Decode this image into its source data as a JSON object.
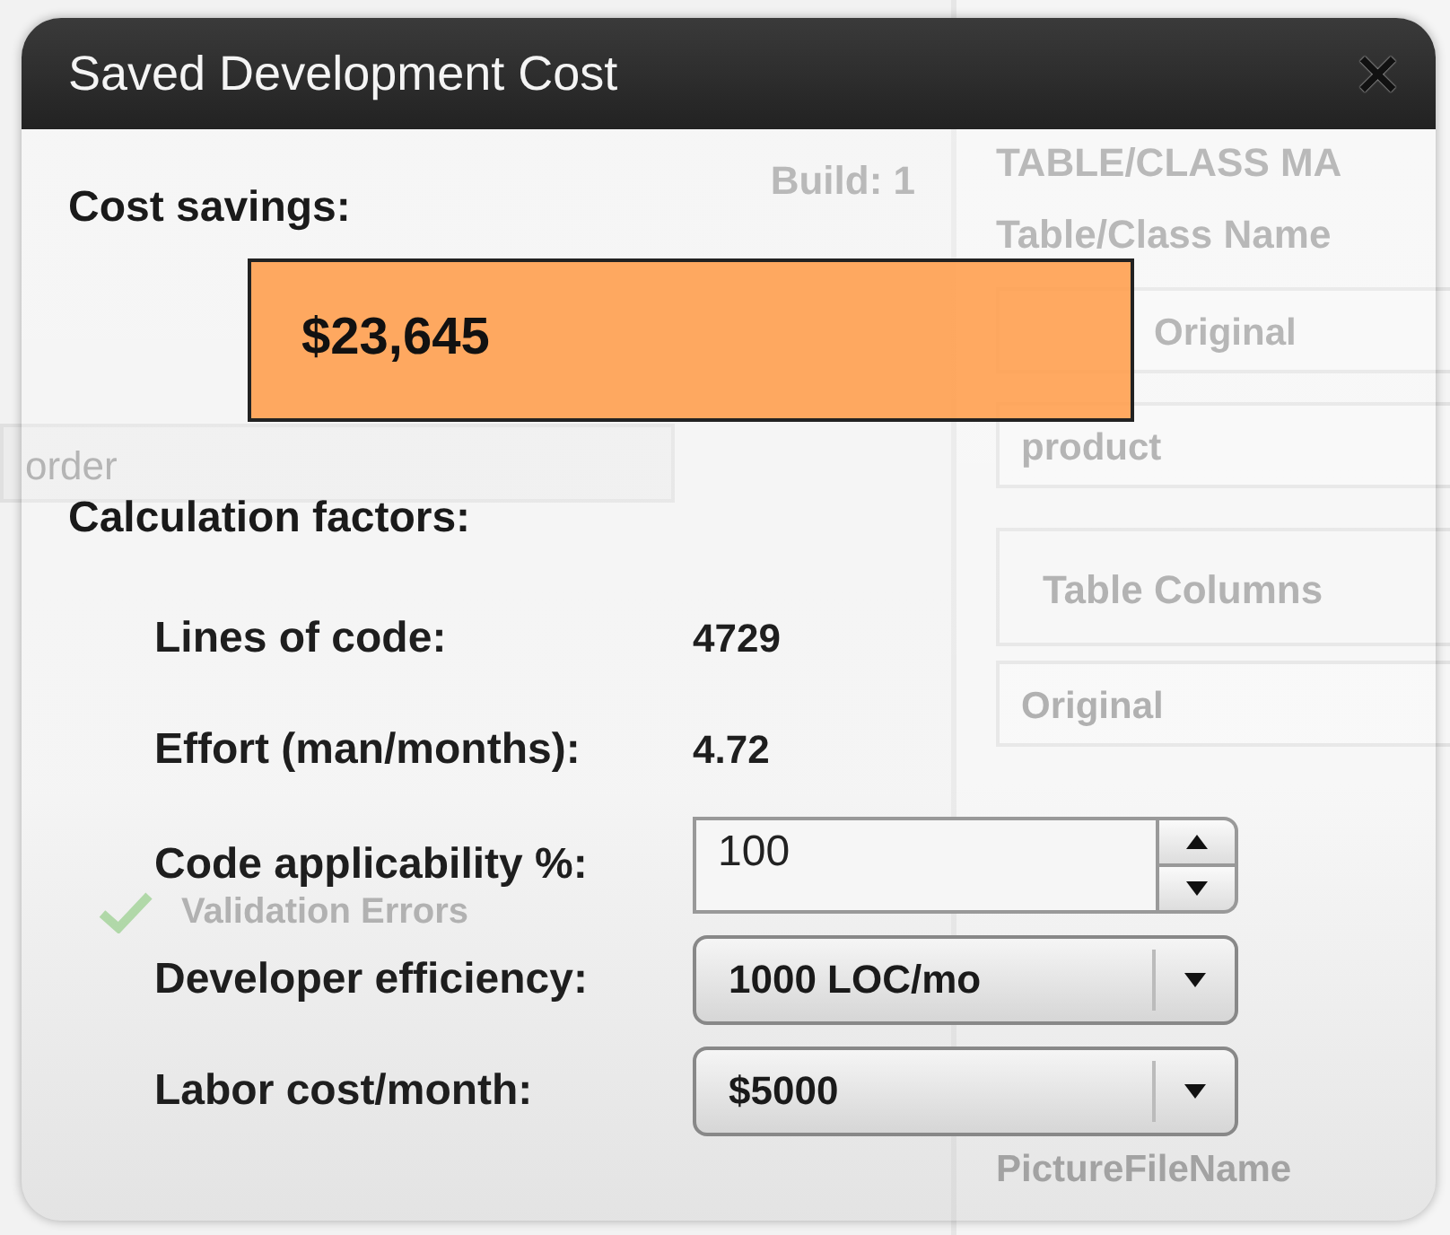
{
  "window": {
    "title": "Saved Development Cost",
    "close": "×"
  },
  "cost_savings": {
    "label": "Cost savings:",
    "value": "$23,645"
  },
  "factors": {
    "heading": "Calculation factors:",
    "rows": [
      {
        "kind": "text",
        "label": "Lines of code:",
        "value": "4729"
      },
      {
        "kind": "text",
        "label": "Effort (man/months):",
        "value": "4.72"
      },
      {
        "kind": "spinner",
        "label": "Code applicability %:",
        "value": "100"
      },
      {
        "kind": "dropdown",
        "label": "Developer efficiency:",
        "value": "1000 LOC/mo"
      },
      {
        "kind": "dropdown",
        "label": "Labor cost/month:",
        "value": "$5000"
      }
    ]
  },
  "background": {
    "build": "Build: 1",
    "list_items": [
      "order"
    ],
    "validation": "Validation Errors",
    "panel_title": "TABLE/CLASS MA",
    "name_label": "Table/Class Name",
    "fields": [
      "Original",
      "product"
    ],
    "columns_label": "Table Columns",
    "columns": [
      "Original",
      "PictureFileName"
    ]
  }
}
